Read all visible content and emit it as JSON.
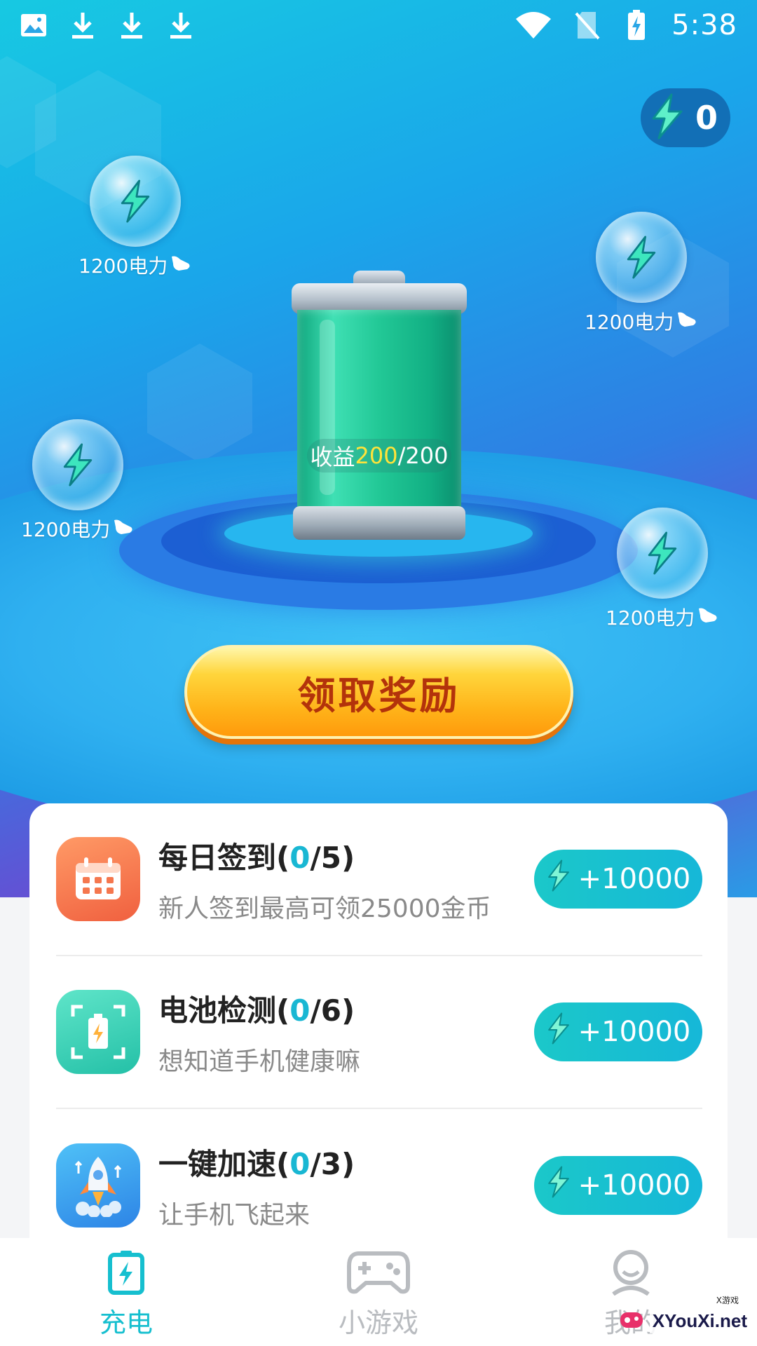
{
  "status_bar": {
    "time": "5:38"
  },
  "power_counter": {
    "value": "0"
  },
  "bubbles": [
    {
      "label": "1200电力"
    },
    {
      "label": "1200电力"
    },
    {
      "label": "1200电力"
    },
    {
      "label": "1200电力"
    }
  ],
  "battery": {
    "earnings_prefix": "收益",
    "earnings_current": "200",
    "earnings_total": "/200"
  },
  "claim_button": {
    "label": "领取奖励"
  },
  "tasks": [
    {
      "title": "每日签到",
      "prog_open": "(",
      "progress": "0",
      "prog_rest": "/5)",
      "subtitle": "新人签到最高可领25000金币",
      "reward": "+10000",
      "icon": "calendar-icon"
    },
    {
      "title": "电池检测",
      "prog_open": "(",
      "progress": "0",
      "prog_rest": "/6)",
      "subtitle": "想知道手机健康嘛",
      "reward": "+10000",
      "icon": "battery-scan-icon"
    },
    {
      "title": "一键加速",
      "prog_open": "(",
      "progress": "0",
      "prog_rest": "/3)",
      "subtitle": "让手机飞起来",
      "reward": "+10000",
      "icon": "rocket-icon"
    }
  ],
  "bottom_nav": [
    {
      "label": "充电",
      "icon": "battery-charge-icon",
      "active": true
    },
    {
      "label": "小游戏",
      "icon": "gamepad-icon",
      "active": false
    },
    {
      "label": "我的",
      "icon": "profile-icon",
      "active": false
    }
  ],
  "watermark": {
    "text": "XYouXi.net",
    "small": "X游戏"
  },
  "colors": {
    "accent": "#16bfcf",
    "progress": "#19b7d3",
    "claim_text": "#b3330b",
    "highlight": "#ffe33a"
  }
}
